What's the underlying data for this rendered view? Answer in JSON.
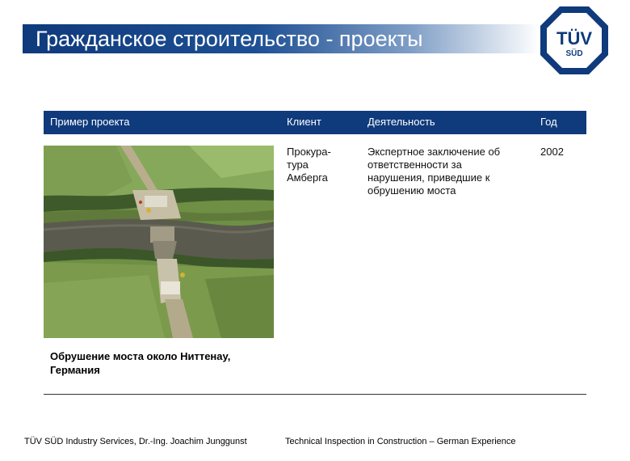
{
  "slide": {
    "title": "Гражданское строительство - проекты"
  },
  "logo": {
    "line1": "TÜV",
    "line2": "SÜD"
  },
  "table": {
    "headers": {
      "project": "Пример проекта",
      "client": "Клиент",
      "activity": "Деятельность",
      "year": "Год"
    },
    "row": {
      "client_lines": [
        "Прокура-",
        "тура",
        "Амберга"
      ],
      "activity_lines": [
        "Экспертное заключение об",
        "ответственности за",
        "нарушения, приведшие к",
        "обрушению моста"
      ],
      "year": "2002"
    }
  },
  "caption": {
    "line1": "Обрушение моста около Ниттенау,",
    "line2": "Германия"
  },
  "footer": {
    "left": "TÜV SÜD Industry Services, Dr.-Ing. Joachim Junggunst",
    "right": "Technical Inspection in Construction – German Experience"
  },
  "colors": {
    "brand_blue": "#0f3a7c",
    "header_text": "#ffffff"
  }
}
